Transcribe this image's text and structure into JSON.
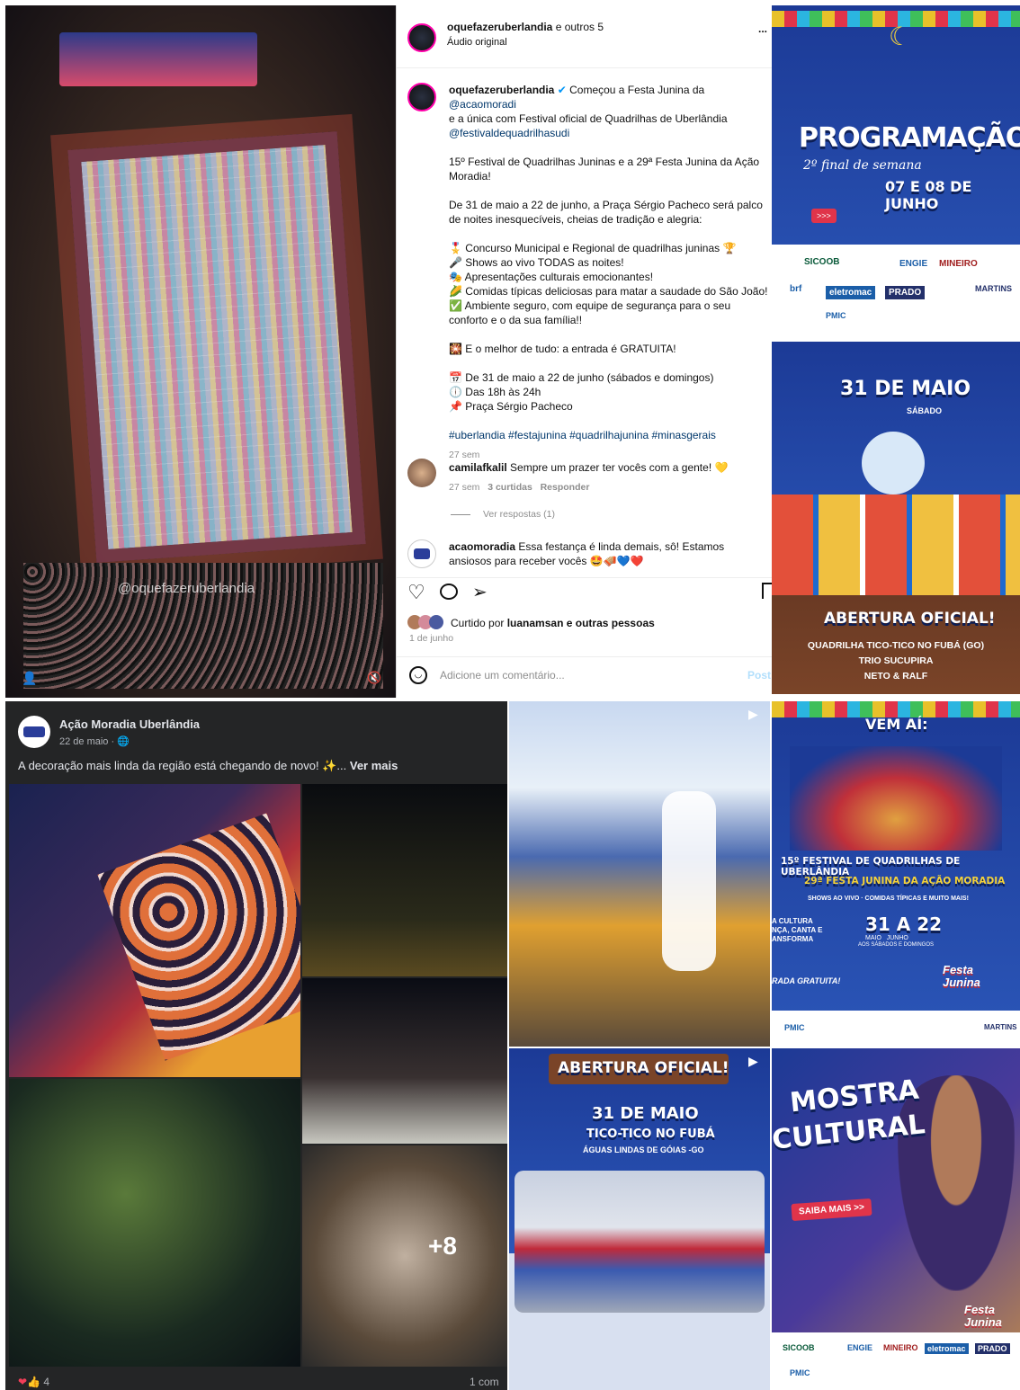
{
  "instagram": {
    "header_user": "oquefazeruberlandia",
    "header_suffix": " e outros 5",
    "audio": "Áudio original",
    "more": "...",
    "caption_user": "oquefazeruberlandia",
    "caption_l1": "Começou a Festa Junina da ",
    "mention1": "@acaomoradi",
    "caption_l2": "e a única com Festival oficial de Quadrilhas de Uberlândia",
    "mention2": "@festivaldequadrilhasudi",
    "p2": "15º Festival de Quadrilhas Juninas e a 29ª Festa Junina da Ação Moradia!",
    "p3": "De 31 de maio a 22 de junho, a Praça Sérgio Pacheco será palco de noites inesquecíveis, cheias de tradição e alegria:",
    "bullets": [
      "🎖️ Concurso Municipal e Regional de quadrilhas juninas 🏆",
      "🎤 Shows ao vivo TODAS as noites!",
      "🎭 Apresentações culturais emocionantes!",
      "🌽 Comidas típicas deliciosas para matar a saudade do São João!",
      "✅ Ambiente seguro, com equipe de segurança para o seu conforto e o da sua família!!"
    ],
    "p5": "🎇 E o melhor de tudo: a entrada é GRATUITA!",
    "info": [
      "📅 De 31 de maio a 22 de junho (sábados e domingos)",
      "🕕 Das 18h às 24h",
      "📌 Praça Sérgio Pacheco"
    ],
    "hashtags": "#uberlandia #festajunina #quadrilhajunina #minasgerais",
    "caption_time": "27 sem",
    "c1_user": "camilafkalil",
    "c1_text": " Sempre um prazer ter vocês com a gente! 💛",
    "c1_time": "27 sem",
    "c1_likes": "3 curtidas",
    "c1_reply": "Responder",
    "view_replies": "Ver respostas (1)",
    "c2_user": "acaomoradia",
    "c2_text": " Essa festança é linda demais, sô! Estamos ansiosos para receber vocês 🤩🪗💙❤️",
    "liked_by_pre": "Curtido por ",
    "liked_user": "luanamsan",
    "liked_post": " e outras pessoas",
    "date": "1 de junho",
    "comment_placeholder": "Adicione um comentário...",
    "post_btn": "Post",
    "watermark": "@oquefazeruberlandia"
  },
  "poster1": {
    "title": "PROGRAMAÇÃO",
    "subtitle": "2º final de semana",
    "dates": "07 E 08 DE JUNHO",
    "arrows": ">>>"
  },
  "poster2": {
    "date": "31 DE MAIO",
    "day": "SÁBADO",
    "headline": "ABERTURA OFICIAL!",
    "l1": "QUADRILHA TICO-TICO NO FUBÁ (GO)",
    "l2": "TRIO SUCUPIRA",
    "l3": "NETO & RALF"
  },
  "sponsors": {
    "a": "SICOOB",
    "b": "ENGIE",
    "c": "MINEIRO",
    "d": "eletromac",
    "e": "PRADO",
    "f": "brf",
    "g": "PMIC",
    "h": "MARTINS"
  },
  "facebook": {
    "page": "Ação Moradia Uberlândia",
    "date": "22 de maio · ",
    "text": "A decoração mais linda da região está chegando de novo! ✨... ",
    "more": "Ver mais",
    "plus": "+8",
    "reactions": "4",
    "comments": "1 com"
  },
  "poster3": {
    "top": "VEM AÍ:",
    "l1": "15º FESTIVAL DE QUADRILHAS DE UBERLÂNDIA",
    "l2": "29ª FESTA JUNINA DA AÇÃO MORADIA",
    "l3": "SHOWS AO VIVO · COMIDAS TÍPICAS E MUITO MAIS!",
    "dates": "31 A 22",
    "months": "MAIO   JUNHO",
    "sub": "AOS SÁBADOS E DOMINGOS",
    "left": "A CULTURA\nNÇA, CANTA E\nANSFORMA",
    "entrada": "RADA GRATUITA!",
    "festa": "Festa Junina"
  },
  "poster4": {
    "title": "ABERTURA OFICIAL!",
    "date": "31 DE MAIO",
    "group": "TICO-TICO NO FUBÁ",
    "city": "ÁGUAS LINDAS DE GÓIAS -GO"
  },
  "poster5": {
    "title1": "MOSTRA",
    "title2": "CULTURAL",
    "btn": "SAIBA MAIS >>",
    "festa": "Festa Junina"
  }
}
